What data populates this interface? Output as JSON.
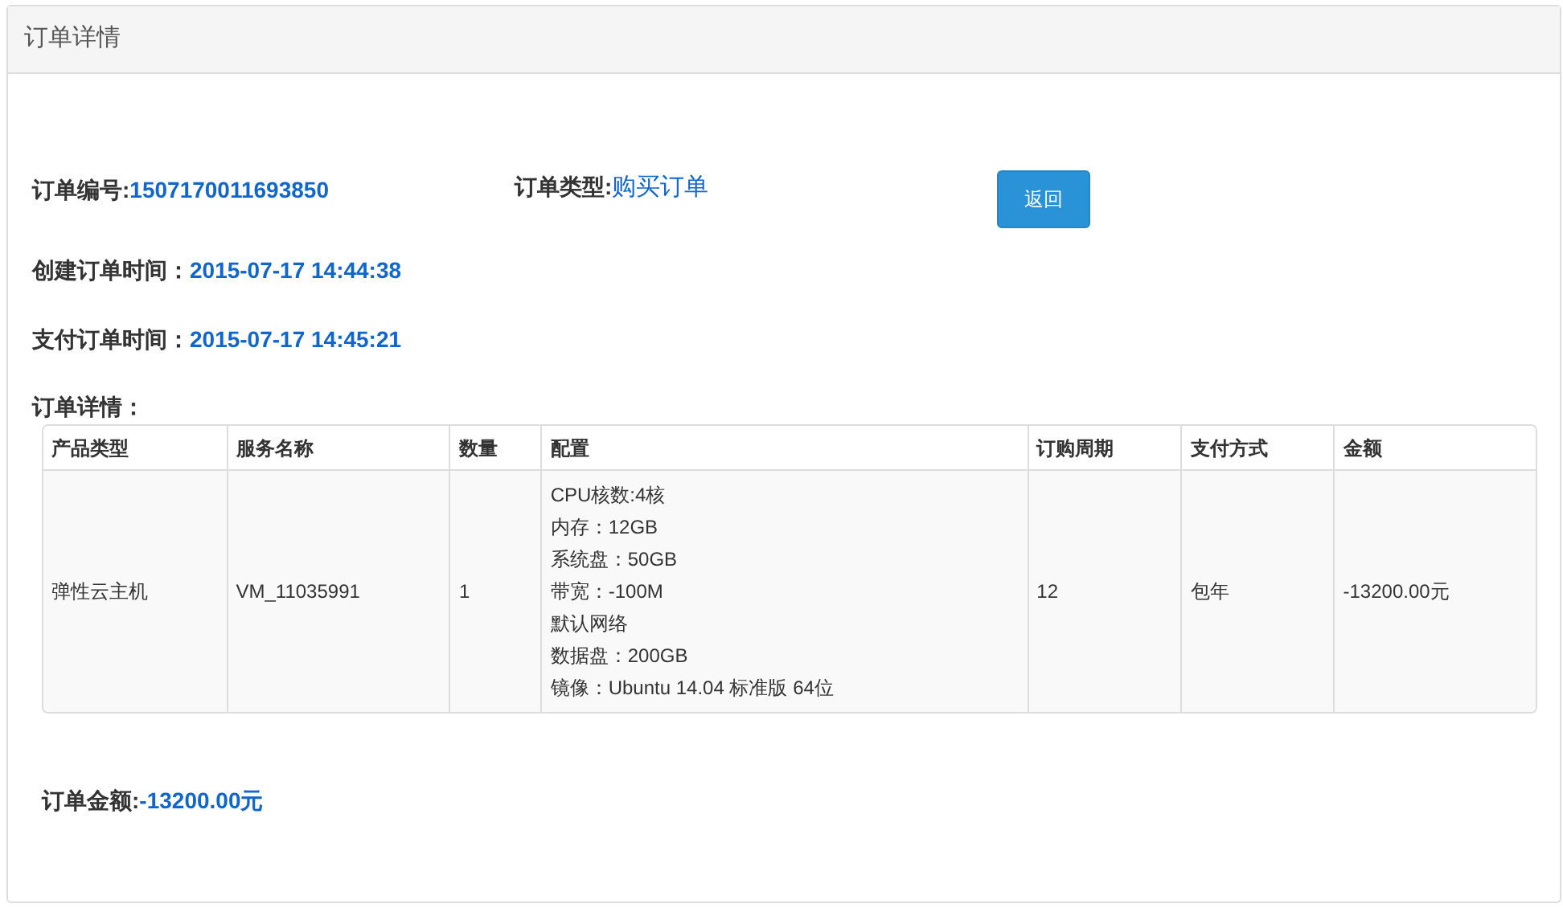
{
  "panel": {
    "title": "订单详情"
  },
  "order_number": {
    "label": "订单编号:",
    "value": "1507170011693850"
  },
  "order_type": {
    "label": "订单类型:",
    "value": "购买订单"
  },
  "back_button": {
    "label": "返回"
  },
  "created_time": {
    "label": "创建订单时间：",
    "value": "2015-07-17 14:44:38"
  },
  "paid_time": {
    "label": "支付订单时间：",
    "value": "2015-07-17 14:45:21"
  },
  "details_label": "订单详情：",
  "table": {
    "columns": [
      "产品类型",
      "服务名称",
      "数量",
      "配置",
      "订购周期",
      "支付方式",
      "金额"
    ],
    "rows": [
      {
        "cells": [
          "弹性云主机",
          "VM_11035991",
          "1",
          [
            "CPU核数:4核",
            "内存：12GB",
            "系统盘：50GB",
            "带宽：-100M",
            "默认网络",
            "数据盘：200GB",
            "镜像：Ubuntu 14.04 标准版 64位"
          ],
          "12",
          "包年",
          "-13200.00元"
        ]
      }
    ]
  },
  "total": {
    "label": "订单金额:",
    "value": "-13200.00元"
  }
}
